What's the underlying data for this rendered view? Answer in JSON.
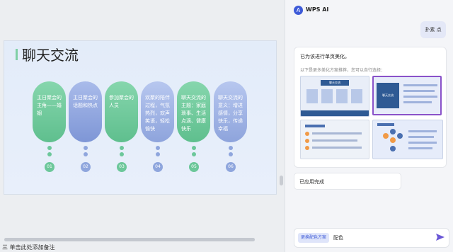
{
  "panel": {
    "logo": "A",
    "title": "WPS AI",
    "user_message": "扑素 点",
    "ai_reply_title": "已为该进行单页美化。",
    "ai_reply_sub": "以下是更多美化方案推荐，您可以自行选择：",
    "done_text": "已应用完成",
    "chip_label": "更换配色方案",
    "input_text": "配色",
    "send_icon": "send-icon"
  },
  "slide": {
    "title": "聊天交流",
    "cards": [
      {
        "text": "主日聚会的主角——婚姻",
        "num": "01"
      },
      {
        "text": "主日聚会的话题和热点",
        "num": "02"
      },
      {
        "text": "参加聚会的人员",
        "num": "03"
      },
      {
        "text": "欢聚的陪伴过程，气氛热烈，欢声笑语，轻松愉快",
        "num": "04"
      },
      {
        "text": "聊天交流的主题：家庭琐事、生活点滴、健康快乐",
        "num": "05"
      },
      {
        "text": "聊天交流的意义：增进感情，分享快乐，传递幸福",
        "num": "06"
      }
    ]
  },
  "thumbs": {
    "t1_title": "聊天交流",
    "t2_title": "聊天交流"
  },
  "status": {
    "text": "三 单击此处添加备注"
  },
  "colors": {
    "green": "#7fcfa5",
    "blue": "#8fa6dd",
    "accent": "#3d5ad8",
    "selected": "#8a52c9"
  }
}
